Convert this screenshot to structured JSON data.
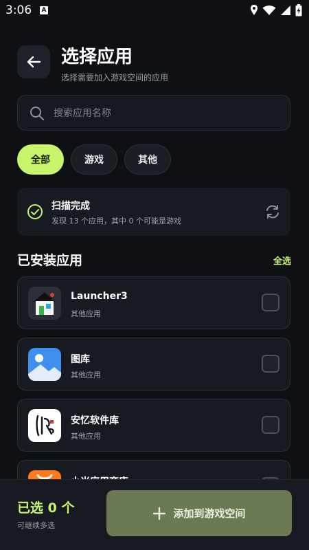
{
  "status_bar": {
    "time": "3:06",
    "notif_icon": "A"
  },
  "header": {
    "title": "选择应用",
    "subtitle": "选择需要加入游戏空间的应用"
  },
  "search": {
    "placeholder": "搜索应用名称",
    "value": ""
  },
  "filters": [
    {
      "label": "全部",
      "active": true
    },
    {
      "label": "游戏",
      "active": false
    },
    {
      "label": "其他",
      "active": false
    }
  ],
  "scan": {
    "title": "扫描完成",
    "description": "发现 13 个应用，其中 0 个可能是游戏"
  },
  "installed": {
    "title": "已安装应用",
    "select_all": "全选",
    "apps": [
      {
        "name": "Launcher3",
        "category": "其他应用",
        "icon": "launcher3-icon",
        "checked": false
      },
      {
        "name": "图库",
        "category": "其他应用",
        "icon": "gallery-icon",
        "checked": false
      },
      {
        "name": "安忆软件库",
        "category": "其他应用",
        "icon": "anyi-store-icon",
        "checked": false
      },
      {
        "name": "小米应用商店",
        "category": "",
        "icon": "mi-store-icon",
        "checked": false
      }
    ]
  },
  "bottom": {
    "selected": "已选 0 个",
    "hint": "可继续多选",
    "add_button": "添加到游戏空间"
  },
  "colors": {
    "accent": "#c6f56b",
    "background": "#0e1014",
    "card": "#171b21",
    "button_disabled": "#6b7a52"
  }
}
